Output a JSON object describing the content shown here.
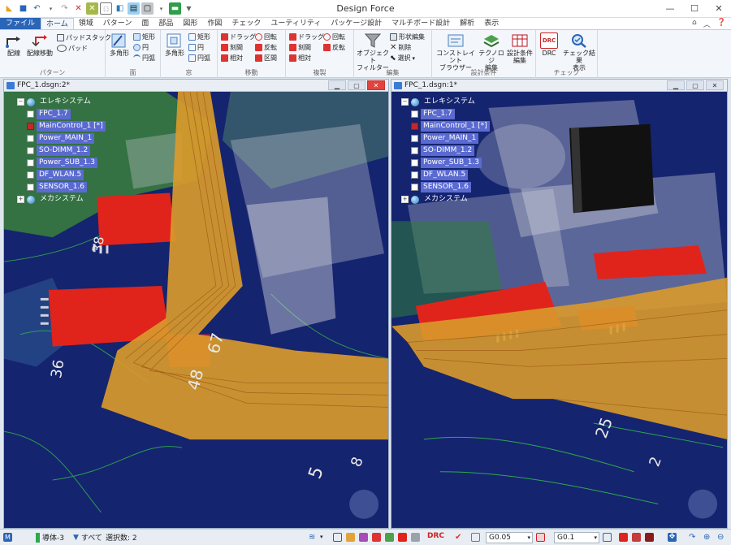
{
  "app": {
    "title": "Design Force"
  },
  "window_controls": {
    "minimize": "—",
    "maximize": "☐",
    "close": "✕"
  },
  "tabs": [
    {
      "label": "ファイル",
      "kind": "file"
    },
    {
      "label": "ホーム",
      "kind": "active"
    },
    {
      "label": "領域"
    },
    {
      "label": "パターン"
    },
    {
      "label": "面"
    },
    {
      "label": "部品"
    },
    {
      "label": "図形"
    },
    {
      "label": "作図"
    },
    {
      "label": "チェック"
    },
    {
      "label": "ユーティリティ"
    },
    {
      "label": "パッケージ設計"
    },
    {
      "label": "マルチボード設計"
    },
    {
      "label": "解析"
    },
    {
      "label": "表示"
    }
  ],
  "ribbon": {
    "pattern": {
      "label": "パターン",
      "wiring": "配線",
      "wiring_move": "配線移動",
      "pad_stack": "パッドスタック",
      "pad": "パッド"
    },
    "surface": {
      "label": "面",
      "polygon": "多角形",
      "rect": "矩形",
      "circle": "円",
      "arc": "円弧"
    },
    "window": {
      "label": "窓",
      "polygon": "多角形",
      "rect": "矩形",
      "circle": "円",
      "arc": "円弧"
    },
    "move": {
      "label": "移動",
      "drag": "ドラッグ",
      "rotate": "回転",
      "interval": "刻間",
      "flip": "反転",
      "relative": "相対",
      "section": "区間"
    },
    "copy": {
      "label": "複製",
      "drag": "ドラッグ",
      "rotate": "回転",
      "interval": "刻間",
      "flip": "反転",
      "relative": "相対"
    },
    "edit": {
      "label": "編集",
      "object_filter_1": "オブジェクト",
      "object_filter_2": "フィルター",
      "shape_edit": "形状編集",
      "delete": "削除",
      "select": "選択"
    },
    "design": {
      "label": "設計条件",
      "constraint_1": "コンストレイント",
      "constraint_2": "ブラウザー",
      "technology_1": "テクノロジ",
      "technology_2": "編集",
      "design_cond_1": "設計条件",
      "design_cond_2": "編集"
    },
    "check": {
      "label": "チェック",
      "drc": "DRC",
      "check_result_1": "チェック結果",
      "check_result_2": "表示",
      "drc_icon_text": "DRC"
    }
  },
  "panels": [
    {
      "title": "FPC_1.dsgn:2*",
      "tree": {
        "root": "エレキシステム",
        "items": [
          {
            "label": "FPC_1.7",
            "red": false
          },
          {
            "label": "MainControl_1 [*]",
            "red": true
          },
          {
            "label": "Power_MAIN_1",
            "red": false
          },
          {
            "label": "SO-DIMM_1.2",
            "red": false
          },
          {
            "label": "Power_SUB_1.3",
            "red": false
          },
          {
            "label": "DF_WLAN.5",
            "red": false
          },
          {
            "label": "SENSOR_1.6",
            "red": false
          }
        ],
        "mech": "メカシステム"
      },
      "silk": [
        "67",
        "48",
        "38",
        "36",
        "5",
        "8"
      ]
    },
    {
      "title": "FPC_1.dsgn:1*",
      "tree": {
        "root": "エレキシステム",
        "items": [
          {
            "label": "FPC_1.7",
            "red": false
          },
          {
            "label": "MainControl_1 [*]",
            "red": true
          },
          {
            "label": "Power_MAIN_1",
            "red": false
          },
          {
            "label": "SO-DIMM_1.2",
            "red": false
          },
          {
            "label": "Power_SUB_1.3",
            "red": false
          },
          {
            "label": "DF_WLAN.5",
            "red": false
          },
          {
            "label": "SENSOR_1.6",
            "red": false
          }
        ],
        "mech": "メカシステム"
      },
      "silk": [
        "25",
        "2"
      ]
    }
  ],
  "status": {
    "layer": "導体-3",
    "filter": "すべて",
    "selected": "選択数: 2",
    "grid1": "G0.05",
    "grid2": "G0.1",
    "drc": "DRC"
  },
  "colors": {
    "board": "#14236e",
    "copper": "#2f7d3a",
    "component": "#e0241b",
    "fpc": "#d99a2b",
    "accent": "#2b65b7"
  }
}
